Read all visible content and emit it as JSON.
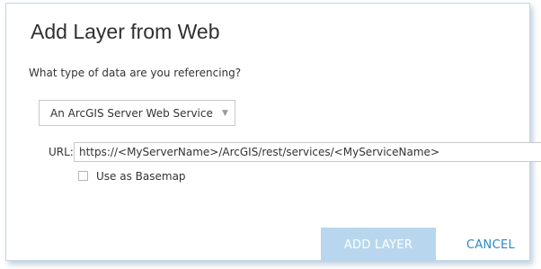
{
  "dialog": {
    "title": "Add Layer from Web",
    "prompt": "What type of data are you referencing?",
    "data_type_select": {
      "selected": "An ArcGIS Server Web Service",
      "caret_icon": "chevron-down-icon"
    },
    "url": {
      "label": "URL:",
      "value": "https://<MyServerName>/ArcGIS/rest/services/<MyServiceName>"
    },
    "basemap_checkbox": {
      "label": "Use as Basemap",
      "checked": false
    },
    "buttons": {
      "add_layer": "ADD LAYER",
      "cancel": "CANCEL"
    }
  },
  "colors": {
    "add_button_disabled": "#b8d7ee",
    "cancel_text": "#2c88c7",
    "dialog_border": "#c7d6e4"
  }
}
